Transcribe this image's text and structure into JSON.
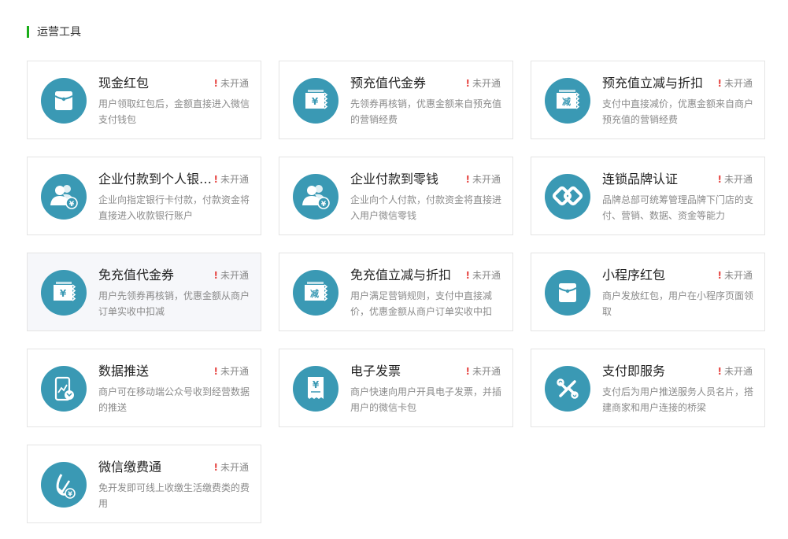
{
  "section": {
    "title": "运营工具"
  },
  "colors": {
    "accent": "#1aad19",
    "icon_bg": "#3a99b4",
    "status_mark": "#e64340"
  },
  "cards": [
    {
      "title": "现金红包",
      "status": "未开通",
      "desc": "用户领取红包后，金额直接进入微信支付钱包",
      "icon": "red-packet-icon"
    },
    {
      "title": "预充值代金券",
      "status": "未开通",
      "desc": "先领券再核销，优惠金额来自预充值的营销经费",
      "icon": "voucher-yen-icon"
    },
    {
      "title": "预充值立减与折扣",
      "status": "未开通",
      "desc": "支付中直接减价，优惠金额来自商户预充值的营销经费",
      "icon": "discount-ticket-icon"
    },
    {
      "title": "企业付款到个人银…",
      "status": "未开通",
      "desc": "企业向指定银行卡付款，付款资金将直接进入收款银行账户",
      "icon": "users-payment-icon"
    },
    {
      "title": "企业付款到零钱",
      "status": "未开通",
      "desc": "企业向个人付款，付款资金将直接进入用户微信零钱",
      "icon": "users-payment-icon"
    },
    {
      "title": "连锁品牌认证",
      "status": "未开通",
      "desc": "品牌总部可统筹管理品牌下门店的支付、营销、数据、资金等能力",
      "icon": "chain-link-icon"
    },
    {
      "title": "免充值代金券",
      "status": "未开通",
      "desc": "用户先领券再核销，优惠金额从商户订单实收中扣减",
      "icon": "voucher-yen-icon"
    },
    {
      "title": "免充值立减与折扣",
      "status": "未开通",
      "desc": "用户满足营销规则，支付中直接减价，优惠金额从商户订单实收中扣",
      "icon": "discount-ticket-icon"
    },
    {
      "title": "小程序红包",
      "status": "未开通",
      "desc": "商户发放红包，用户在小程序页面领取",
      "icon": "red-packet-icon"
    },
    {
      "title": "数据推送",
      "status": "未开通",
      "desc": "商户可在移动端公众号收到经营数据的推送",
      "icon": "phone-chart-icon"
    },
    {
      "title": "电子发票",
      "status": "未开通",
      "desc": "商户快速向用户开具电子发票，并插用户的微信卡包",
      "icon": "invoice-icon"
    },
    {
      "title": "支付即服务",
      "status": "未开通",
      "desc": "支付后为用户推送服务人员名片，搭建商家和用户连接的桥梁",
      "icon": "service-link-icon"
    },
    {
      "title": "微信缴费通",
      "status": "未开通",
      "desc": "免开发即可线上收缴生活缴费类的费用",
      "icon": "bill-pay-icon"
    }
  ]
}
